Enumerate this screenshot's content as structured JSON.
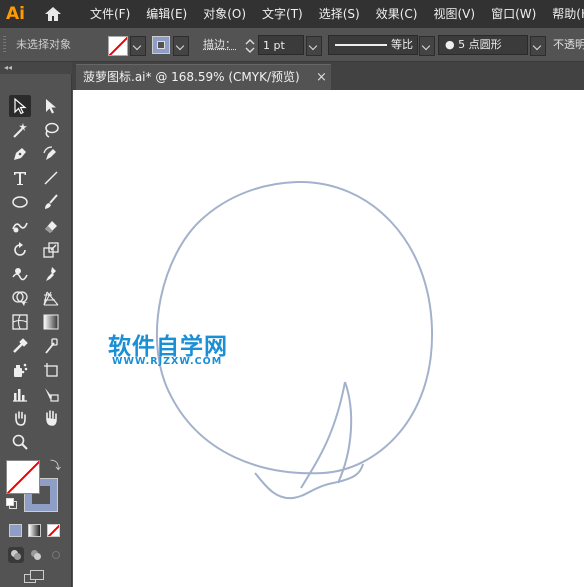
{
  "app": {
    "logo_text": "Ai",
    "menus": [
      "文件(F)",
      "编辑(E)",
      "对象(O)",
      "文字(T)",
      "选择(S)",
      "效果(C)",
      "视图(V)",
      "窗口(W)",
      "帮助(H)"
    ]
  },
  "control_bar": {
    "selection_label": "未选择对象",
    "stroke_label": "描边：",
    "stroke_weight": "1 pt",
    "profile_label": "等比",
    "brush_label": "●  5 点圆形",
    "opacity_label": "不透明"
  },
  "document": {
    "tab_title": "菠萝图标.ai* @ 168.59% (CMYK/预览)",
    "close_symbol": "×"
  },
  "watermark": {
    "title": "软件自学网",
    "url": "WWW.RJZXW.COM"
  },
  "colors": {
    "menubar_bg": "#323232",
    "panel_bg": "#535353",
    "canvas_bg": "#ffffff",
    "shape_stroke": "#a3b1cc",
    "logo": "#ff9a00",
    "watermark": "#1a8fd6"
  },
  "tools": [
    "selection-tool",
    "direct-selection-tool",
    "magic-wand-tool",
    "lasso-tool",
    "pen-tool",
    "curvature-tool",
    "type-tool",
    "line-segment-tool",
    "ellipse-tool",
    "paintbrush-tool",
    "shaper-tool",
    "eraser-tool",
    "rotate-tool",
    "scale-tool",
    "warp-tool",
    "puppet-warp-tool",
    "shape-builder-tool",
    "perspective-grid-tool",
    "mesh-tool",
    "gradient-tool",
    "eyedropper-tool",
    "blend-tool",
    "symbol-sprayer-tool",
    "artboard-tool",
    "column-graph-tool",
    "slice-tool",
    "hand-tool",
    "zoom-tool"
  ]
}
